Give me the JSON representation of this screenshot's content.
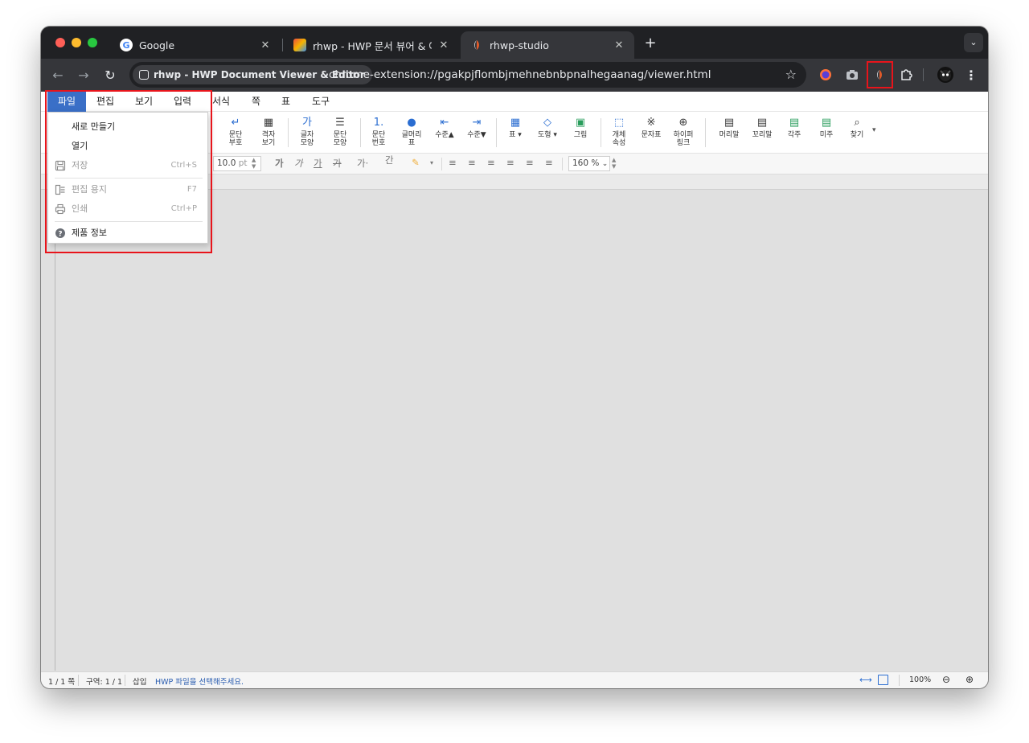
{
  "browser": {
    "tabs": [
      {
        "title": "Google",
        "active": false
      },
      {
        "title": "rhwp - HWP 문서 뷰어 & 에디터",
        "active": false
      },
      {
        "title": "rhwp-studio",
        "active": true
      }
    ],
    "site_chip": "rhwp - HWP Document Viewer & Editor",
    "url": "chrome-extension://pgakpjflombjmehnebnbpnalhegaanag/viewer.html"
  },
  "menubar": {
    "items": [
      "파일",
      "편집",
      "보기",
      "입력",
      "서식",
      "쪽",
      "표",
      "도구"
    ],
    "active": "파일"
  },
  "file_menu": {
    "items": [
      {
        "label": "새로 만들기",
        "shortcut": "",
        "enabled": true,
        "icon": ""
      },
      {
        "label": "열기",
        "shortcut": "",
        "enabled": true,
        "icon": ""
      },
      {
        "label": "저장",
        "shortcut": "Ctrl+S",
        "enabled": false,
        "icon": "save-icon"
      },
      {
        "label": "편집 용지",
        "shortcut": "F7",
        "enabled": false,
        "icon": "page-setup-icon"
      },
      {
        "label": "인쇄",
        "shortcut": "Ctrl+P",
        "enabled": false,
        "icon": "print-icon"
      },
      {
        "label": "제품 정보",
        "shortcut": "",
        "enabled": true,
        "icon": "help-icon"
      }
    ]
  },
  "ribbon": {
    "buttons": [
      {
        "label1": "문단",
        "label2": "부호"
      },
      {
        "label1": "격자",
        "label2": "보기"
      },
      {
        "label1": "글자",
        "label2": "모양",
        "top": "가"
      },
      {
        "label1": "문단",
        "label2": "모양"
      },
      {
        "label1": "문단",
        "label2": "번호",
        "top": "1."
      },
      {
        "label1": "글머리",
        "label2": "표"
      },
      {
        "label1": "수준▲",
        "label2": ""
      },
      {
        "label1": "수준▼",
        "label2": ""
      },
      {
        "label1": "표 ▾",
        "label2": ""
      },
      {
        "label1": "도형 ▾",
        "label2": ""
      },
      {
        "label1": "그림",
        "label2": ""
      },
      {
        "label1": "개체",
        "label2": "속성"
      },
      {
        "label1": "문자표",
        "label2": ""
      },
      {
        "label1": "하이퍼",
        "label2": "링크"
      },
      {
        "label1": "머리말",
        "label2": ""
      },
      {
        "label1": "꼬리말",
        "label2": ""
      },
      {
        "label1": "각주",
        "label2": ""
      },
      {
        "label1": "미주",
        "label2": ""
      },
      {
        "label1": "찾기",
        "label2": ""
      }
    ]
  },
  "format_bar": {
    "font_size": "10.0",
    "font_unit": "pt",
    "glyphs": [
      "가",
      "가",
      "가",
      "가",
      "가·",
      "간"
    ],
    "zoom": "160 %"
  },
  "status": {
    "page": "1 / 1 쪽",
    "section": "구역: 1 / 1",
    "mode": "삽입",
    "message": "HWP 파일을 선택해주세요.",
    "zoom": "100%"
  },
  "colors": {
    "accent": "#3a6fc7",
    "highlight": "#e8141b",
    "status_message": "#2a5db0"
  }
}
